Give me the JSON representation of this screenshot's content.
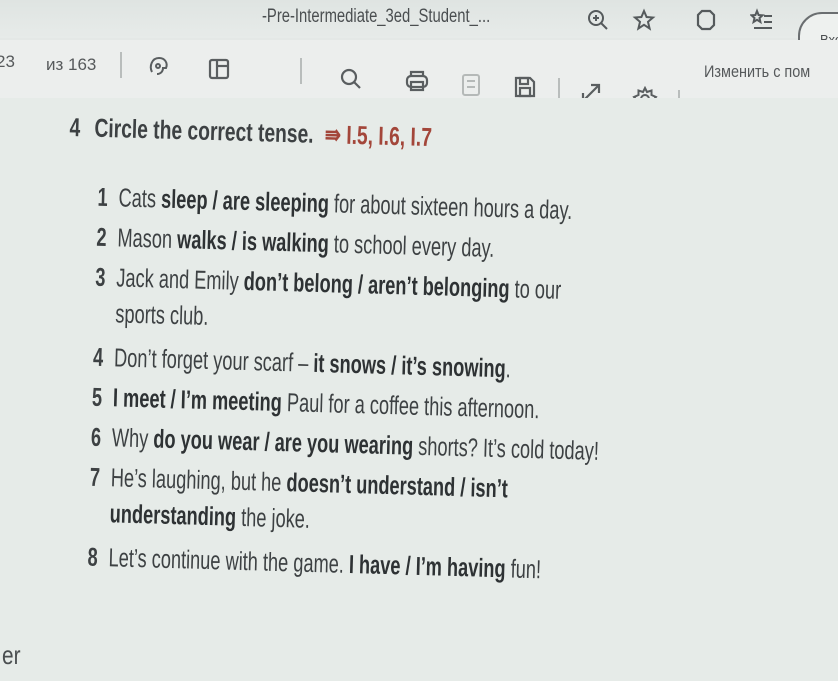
{
  "browser": {
    "tab_title": "-Pre-Intermediate_3ed_Student_...",
    "login_label": "Вхо"
  },
  "pdf_toolbar": {
    "page_number": "23",
    "page_total": "из 163",
    "edit_label": "Изменить с пом"
  },
  "exercise": {
    "number": "4",
    "instruction": "Circle the correct tense.",
    "reference": "⇛ I.5, I.6, I.7",
    "items": [
      {
        "num": "1",
        "before": "Cats ",
        "choice": "sleep / are sleeping",
        "after": " for about sixteen hours a day.",
        "cont_before": "",
        "cont_choice": "",
        "cont_after": ""
      },
      {
        "num": "2",
        "before": "Mason ",
        "choice": "walks / is walking",
        "after": " to school every day.",
        "cont_before": "",
        "cont_choice": "",
        "cont_after": ""
      },
      {
        "num": "3",
        "before": "Jack and Emily ",
        "choice": "don’t belong / aren’t belonging",
        "after": " to our",
        "cont_before": "sports club.",
        "cont_choice": "",
        "cont_after": ""
      },
      {
        "num": "4",
        "before": "Don’t forget your scarf – ",
        "choice": "it snows / it’s snowing",
        "after": ".",
        "cont_before": "",
        "cont_choice": "",
        "cont_after": ""
      },
      {
        "num": "5",
        "before": "",
        "choice": "I meet / I’m meeting",
        "after": " Paul for a coffee this afternoon.",
        "cont_before": "",
        "cont_choice": "",
        "cont_after": ""
      },
      {
        "num": "6",
        "before": "Why ",
        "choice": "do you wear / are you wearing",
        "after": " shorts? It’s cold today!",
        "cont_before": "",
        "cont_choice": "",
        "cont_after": ""
      },
      {
        "num": "7",
        "before": "He’s laughing, but he ",
        "choice": "doesn’t understand / isn’t",
        "after": "",
        "cont_before": "",
        "cont_choice": "understanding",
        "cont_after": " the joke."
      },
      {
        "num": "8",
        "before": "Let’s continue with the game. ",
        "choice": "I have / I’m having",
        "after": " fun!",
        "cont_before": "",
        "cont_choice": "",
        "cont_after": ""
      }
    ]
  },
  "edge_text": "er"
}
